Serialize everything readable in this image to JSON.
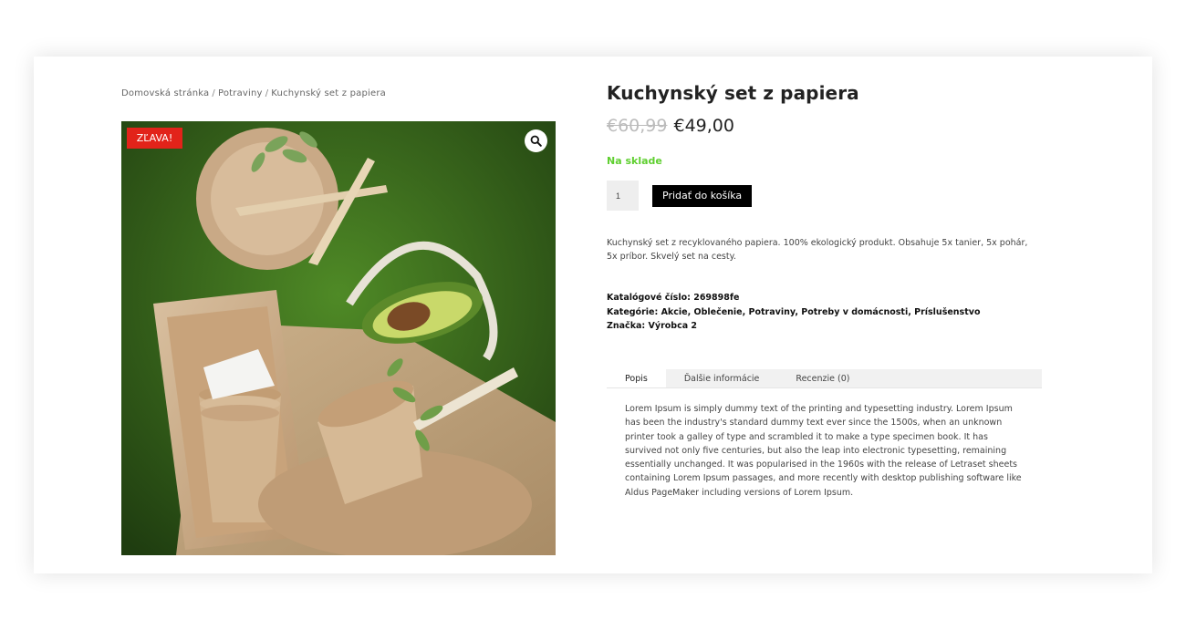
{
  "breadcrumb": {
    "home": "Domovská stránka",
    "category": "Potraviny",
    "current": "Kuchynský set z papiera",
    "separator": "/"
  },
  "gallery": {
    "sale_badge": "ZĽAVA!",
    "zoom_icon": "search-icon"
  },
  "product": {
    "title": "Kuchynský set z papiera",
    "old_price": "€60,99",
    "price": "€49,00",
    "stock": "Na sklade",
    "quantity": "1",
    "add_to_cart": "Pridať do košíka",
    "short_description": "Kuchynský set z recyklovaného papiera. 100% ekologický produkt. Obsahuje 5x tanier, 5x pohár, 5x príbor. Skvelý set na cesty."
  },
  "meta": {
    "sku": "Katalógové číslo: 269898fe",
    "categories": "Kategórie: Akcie, Oblečenie, Potraviny, Potreby v domácnosti, Príslušenstvo",
    "brand": "Značka: Výrobca 2"
  },
  "tabs": [
    {
      "label": "Popis"
    },
    {
      "label": "Ďalšie informácie"
    },
    {
      "label": "Recenzie (0)"
    }
  ],
  "tab_content": "Lorem Ipsum is simply dummy text of the printing and typesetting industry. Lorem Ipsum has been the industry's standard dummy text ever since the 1500s, when an unknown printer took a galley of type and scrambled it to make a type specimen book. It has survived not only five centuries, but also the leap into electronic typesetting, remaining essentially unchanged. It was popularised in the 1960s with the release of Letraset sheets containing Lorem Ipsum passages, and more recently with desktop publishing software like Aldus PageMaker including versions of Lorem Ipsum.",
  "colors": {
    "sale_badge": "#e2231a",
    "in_stock": "#5fcf30",
    "button": "#000000"
  }
}
